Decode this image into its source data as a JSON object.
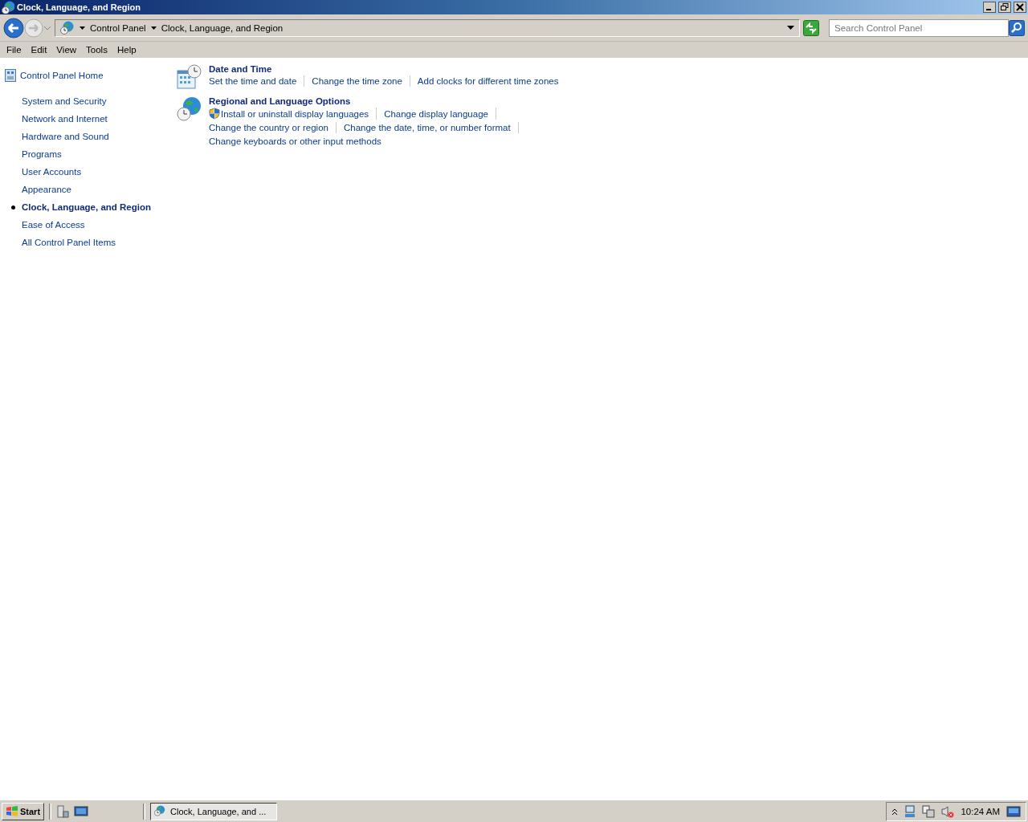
{
  "window": {
    "title": "Clock, Language, and Region"
  },
  "address_bar": {
    "breadcrumbs": [
      "Control Panel",
      "Clock, Language, and Region"
    ]
  },
  "search": {
    "placeholder": "Search Control Panel"
  },
  "menu": [
    "File",
    "Edit",
    "View",
    "Tools",
    "Help"
  ],
  "sidebar": {
    "home": "Control Panel Home",
    "items": [
      {
        "label": "System and Security",
        "selected": false
      },
      {
        "label": "Network and Internet",
        "selected": false
      },
      {
        "label": "Hardware and Sound",
        "selected": false
      },
      {
        "label": "Programs",
        "selected": false
      },
      {
        "label": "User Accounts",
        "selected": false
      },
      {
        "label": "Appearance",
        "selected": false
      },
      {
        "label": "Clock, Language, and Region",
        "selected": true
      },
      {
        "label": "Ease of Access",
        "selected": false
      },
      {
        "label": "All Control Panel Items",
        "selected": false
      }
    ]
  },
  "categories": [
    {
      "title": "Date and Time",
      "kind": "calendar",
      "links": [
        {
          "label": "Set the time and date",
          "shield": false
        },
        {
          "label": "Change the time zone",
          "shield": false
        },
        {
          "label": "Add clocks for different time zones",
          "shield": false
        }
      ]
    },
    {
      "title": "Regional and Language Options",
      "kind": "globe",
      "links": [
        {
          "label": "Install or uninstall display languages",
          "shield": true
        },
        {
          "label": "Change display language",
          "shield": false
        },
        {
          "label": "Change the country or region",
          "shield": false
        },
        {
          "label": "Change the date, time, or number format",
          "shield": false
        },
        {
          "label": "Change keyboards or other input methods",
          "shield": false
        }
      ]
    }
  ],
  "taskbar": {
    "start": "Start",
    "tasks": [
      {
        "label": "Clock, Language, and ...",
        "selected": true
      }
    ],
    "clock": "10:24 AM"
  }
}
